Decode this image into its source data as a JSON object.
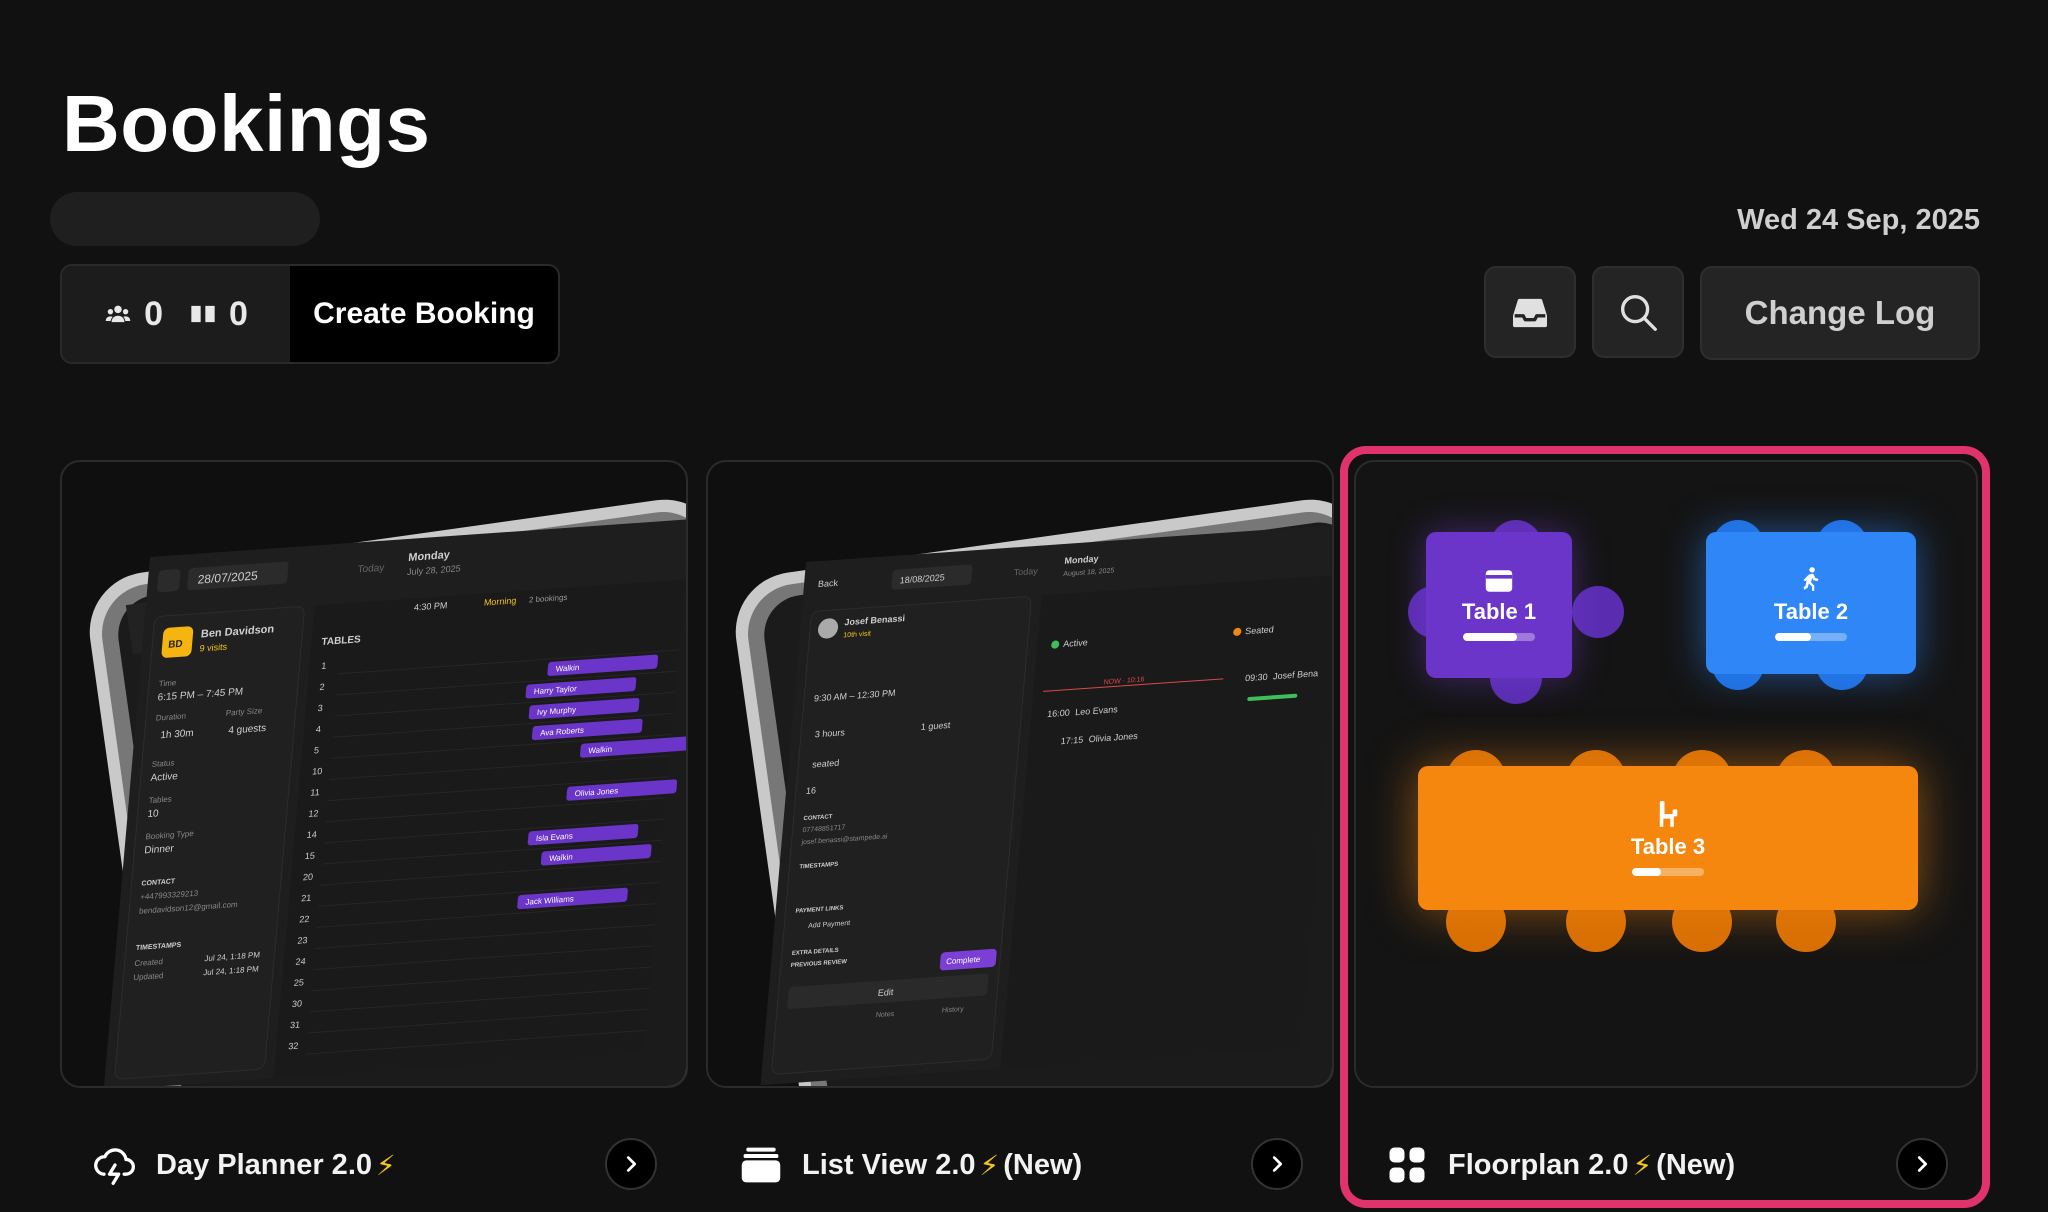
{
  "header": {
    "title": "Bookings",
    "date": "Wed 24 Sep, 2025"
  },
  "counts": {
    "guests": "0",
    "tables": "0",
    "create_label": "Create Booking"
  },
  "toolbar": {
    "inbox_icon": "inbox-icon",
    "search_icon": "search-icon",
    "changelog_label": "Change Log"
  },
  "cards": [
    {
      "title": "Day Planner 2.0",
      "suffix": "",
      "icon": "cloud-lightning-icon"
    },
    {
      "title": "List View 2.0",
      "suffix": "(New)",
      "icon": "stack-icon"
    },
    {
      "title": "Floorplan 2.0",
      "suffix": "(New)",
      "icon": "grid-icon"
    }
  ],
  "floorplan": {
    "tables": [
      {
        "label": "Table 1",
        "color": "#6a35c8",
        "progress": 0.75
      },
      {
        "label": "Table 2",
        "color": "#2f86f6",
        "progress": 0.5
      },
      {
        "label": "Table 3",
        "color": "#f5870f",
        "progress": 0.4
      }
    ]
  },
  "day_planner_preview": {
    "date": "28/07/2025",
    "today": "Today",
    "day": "Monday",
    "day_date": "July 28, 2025",
    "guest_name": "Ben Davidson",
    "guest_initials": "BD",
    "visits": "9 visits",
    "time_label": "Time",
    "time_value": "6:15 PM – 7:45 PM",
    "duration_label": "Duration",
    "duration_value": "1h 30m",
    "party_label": "Party Size",
    "party_value": "4 guests",
    "status_label": "Status",
    "status_value": "Active",
    "tables_label": "Tables",
    "tables_value": "10",
    "booking_type_label": "Booking Type",
    "booking_type_value": "Dinner",
    "contact_label": "CONTACT",
    "phone": "+447993329213",
    "email": "bendavidson12@gmail.com",
    "timestamps_label": "TIMESTAMPS",
    "created_label": "Created",
    "created_value": "Jul 24, 1:18 PM",
    "updated_label": "Updated",
    "updated_value": "Jul 24, 1:18 PM",
    "tables_header": "TABLES",
    "time_header": "4:30 PM",
    "morning": "Morning",
    "morning_count": "2 bookings",
    "rows": [
      "1",
      "2",
      "3",
      "4",
      "5",
      "10",
      "11",
      "12",
      "14",
      "15",
      "20",
      "21",
      "22",
      "23",
      "24",
      "25",
      "30",
      "31",
      "32"
    ],
    "bookings": [
      "Walkin",
      "Harry Taylor",
      "Ivy Murphy",
      "Ava Roberts",
      "Walkin",
      "Olivia Jones",
      "Isla Evans",
      "Walkin",
      "Jack Williams"
    ]
  },
  "list_view_preview": {
    "back": "Back",
    "date": "18/08/2025",
    "today": "Today",
    "day": "Monday",
    "day_date": "August 18, 2025",
    "guest_name": "Josef Benassi",
    "visits": "10th visit",
    "time_value": "9:30 AM – 12:30 PM",
    "duration_value": "3 hours",
    "party_value": "1 guest",
    "status_value": "seated",
    "tables_value": "16",
    "contact_label": "CONTACT",
    "phone": "07748851717",
    "email": "josef.benassi@stampede.ai",
    "timestamps_label": "TIMESTAMPS",
    "payment_label": "PAYMENT LINKS",
    "add_payment": "Add Payment",
    "extra_label": "EXTRA DETAILS",
    "review_label": "PREVIOUS REVIEW",
    "edit": "Edit",
    "complete": "Complete",
    "notes": "Notes",
    "history": "History",
    "active_label": "Active",
    "seated_label": "Seated",
    "now_label": "NOW · 10:16",
    "entry1_time": "16:00",
    "entry1_name": "Leo Evans",
    "entry2_time": "17:15",
    "entry2_name": "Olivia Jones",
    "seated_time": "09:30",
    "seated_name": "Josef Bena"
  }
}
